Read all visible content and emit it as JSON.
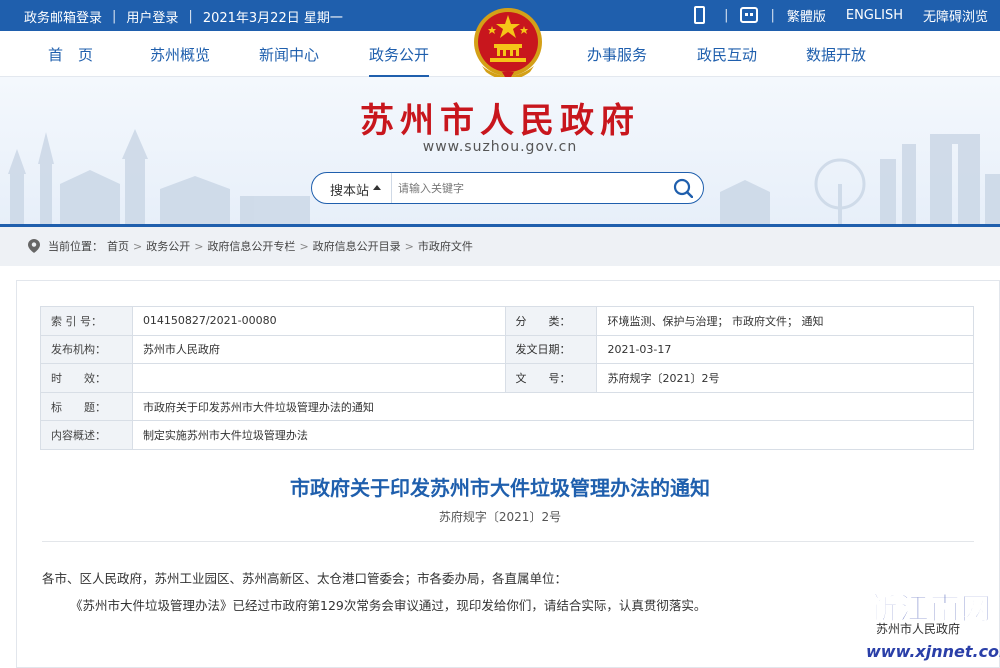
{
  "topbar": {
    "mail_login": "政务邮箱登录",
    "user_login": "用户登录",
    "date": "2021年3月22日 星期一",
    "traditional": "繁體版",
    "english": "ENGLISH",
    "accessible": "无障碍浏览",
    "icons": [
      "phone-icon",
      "robot-icon"
    ]
  },
  "nav": {
    "items": [
      "首　页",
      "苏州概览",
      "新闻中心",
      "政务公开",
      "办事服务",
      "政民互动",
      "数据开放"
    ],
    "active": "政务公开"
  },
  "banner": {
    "title": "苏州市人民政府",
    "url": "www.suzhou.gov.cn",
    "search_scope": "搜本站",
    "search_placeholder": "请输入关键字"
  },
  "breadcrumb": {
    "prefix": "当前位置：",
    "items": [
      "首页",
      "政务公开",
      "政府信息公开专栏",
      "政府信息公开目录",
      "市政府文件"
    ],
    "separator": ">"
  },
  "meta": {
    "index_label": "索 引 号：",
    "index_value": "014150827/2021-00080",
    "category_label": "分　　类：",
    "category_value": "环境监测、保护与治理； 市政府文件； 通知",
    "issuer_label": "发布机构：",
    "issuer_value": "苏州市人民政府",
    "date_label": "发文日期：",
    "date_value": "2021-03-17",
    "validity_label": "时　　效：",
    "validity_value": "",
    "docno_label": "文　　号：",
    "docno_value": "苏府规字〔2021〕2号",
    "title_label": "标　　题：",
    "title_value": "市政府关于印发苏州市大件垃圾管理办法的通知",
    "summary_label": "内容概述：",
    "summary_value": "制定实施苏州市大件垃圾管理办法"
  },
  "document": {
    "title": "市政府关于印发苏州市大件垃圾管理办法的通知",
    "number": "苏府规字〔2021〕2号",
    "para1": "各市、区人民政府，苏州工业园区、苏州高新区、太仓港口管委会；市各委办局，各直属单位：",
    "para2": "《苏州市大件垃圾管理办法》已经过市政府第129次常务会审议通过，现印发给你们，请结合实际，认真贯彻落实。"
  },
  "watermark": {
    "logo": "新江南网",
    "org": "苏州市人民政府",
    "url": "www.xjnnet.com"
  },
  "colors": {
    "primary": "#1f5fad",
    "title_red": "#c8161d"
  }
}
